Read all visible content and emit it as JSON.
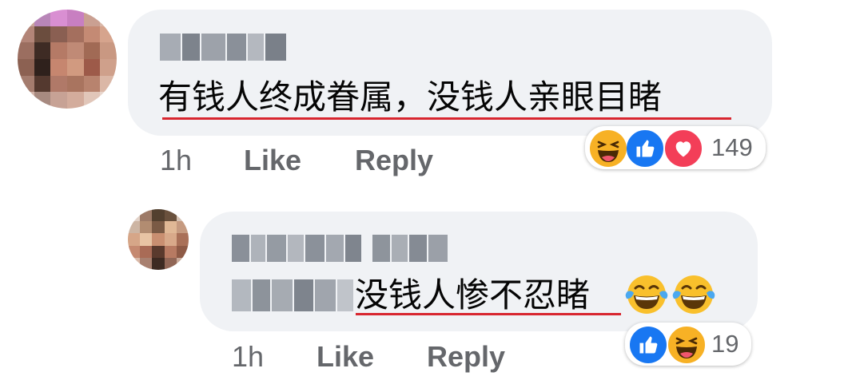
{
  "comments": [
    {
      "author": "",
      "text": "有钱人终成眷属，没钱人亲眼目睹",
      "time": "1h",
      "like_label": "Like",
      "reply_label": "Reply",
      "reactions": [
        "haha",
        "like",
        "love"
      ],
      "reaction_count": "149"
    },
    {
      "author": "",
      "mention": "",
      "text": "没钱人惨不忍睹",
      "time": "1h",
      "like_label": "Like",
      "reply_label": "Reply",
      "reactions": [
        "like",
        "haha"
      ],
      "reaction_count": "19"
    }
  ],
  "colors": {
    "bubble": "#f0f2f5",
    "underline": "#d8262f",
    "like_blue": "#1877f2",
    "love_red": "#f33e58",
    "haha_yellow": "#f7b125",
    "meta_gray": "#65676b"
  },
  "icons": {
    "haha": "laughing-face-icon",
    "like": "thumbs-up-icon",
    "love": "heart-icon",
    "tears": "tears-of-joy-icon"
  }
}
